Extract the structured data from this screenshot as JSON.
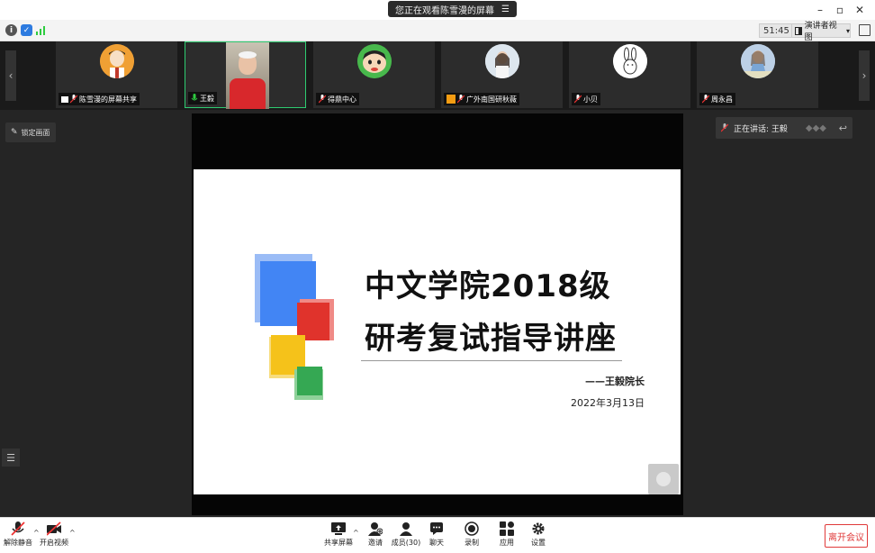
{
  "titlebar": {
    "share_banner": "您正在观看陈雪漫的屏幕",
    "banner_menu_icon": "menu-icon",
    "minimize": "–",
    "restore": "▫",
    "close": "✕"
  },
  "status": {
    "timer": "51:45",
    "view_mode": "演讲者视图",
    "view_caret": "▾"
  },
  "participants": [
    {
      "name": "陈雪漫的屏幕共享",
      "state": "sharing"
    },
    {
      "name": "王毅",
      "state": "speaking"
    },
    {
      "name": "得鼎中心",
      "state": "muted"
    },
    {
      "name": "广外南国研秋薇",
      "state": "muted"
    },
    {
      "name": "小贝",
      "state": "muted"
    },
    {
      "name": "周永昌",
      "state": "muted"
    }
  ],
  "main": {
    "pin_label": "锁定画面",
    "speaker_label": "正在讲话: 王毅"
  },
  "slide": {
    "title_line1": "中文学院2018级",
    "title_line2": "研考复试指导讲座",
    "author": "——王毅院长",
    "date": "2022年3月13日",
    "colors": {
      "blue": "#4285f4",
      "red": "#e0332c",
      "yellow": "#f5c21a",
      "green": "#35a853"
    }
  },
  "toolbar": {
    "unmute": "解除静音",
    "start_video": "开启视频",
    "share_screen": "共享屏幕",
    "invite": "邀请",
    "members": "成员(30)",
    "chat": "聊天",
    "record": "录制",
    "apps": "应用",
    "settings": "设置",
    "leave": "离开会议"
  }
}
